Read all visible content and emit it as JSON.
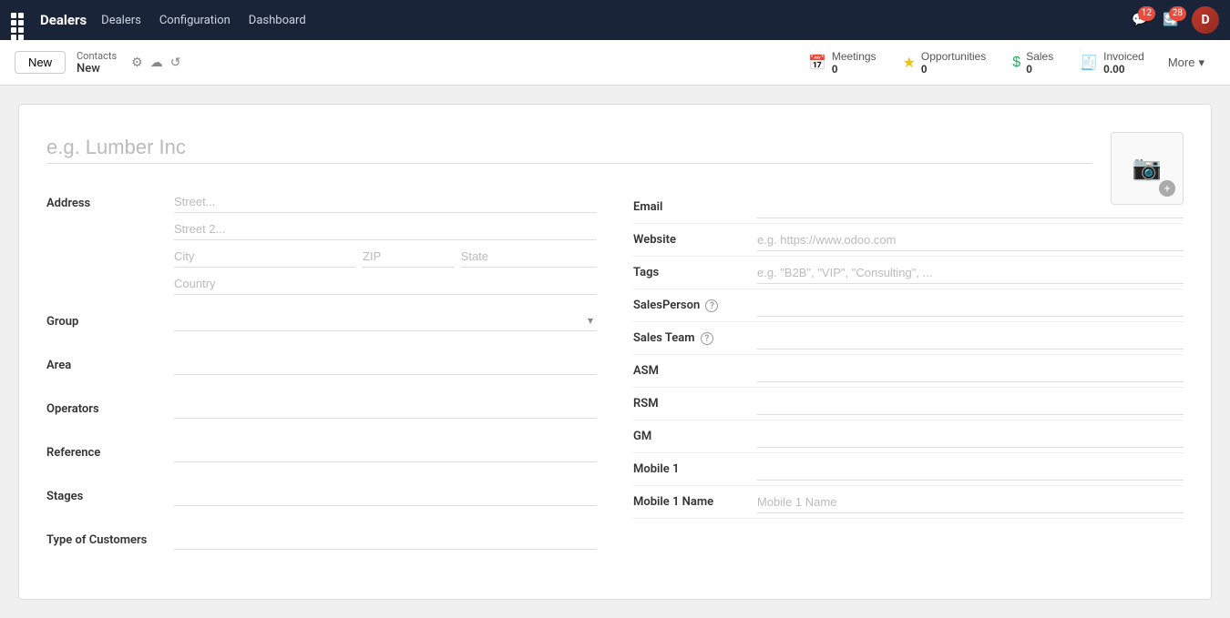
{
  "topnav": {
    "app_title": "Dealers",
    "nav_links": [
      "Dealers",
      "Configuration",
      "Dashboard"
    ],
    "chat_count": "12",
    "refresh_count": "28"
  },
  "actionbar": {
    "new_button": "New",
    "breadcrumb_parent": "Contacts",
    "breadcrumb_current": "New",
    "meetings_label": "Meetings",
    "meetings_count": "0",
    "opportunities_label": "Opportunities",
    "opportunities_count": "0",
    "sales_label": "Sales",
    "sales_count": "0",
    "invoiced_label": "Invoiced",
    "invoiced_count": "0.00",
    "more_label": "More"
  },
  "form": {
    "company_name_placeholder": "e.g. Lumber Inc",
    "address_label": "Address",
    "street_placeholder": "Street...",
    "street2_placeholder": "Street 2...",
    "city_placeholder": "City",
    "zip_placeholder": "ZIP",
    "state_placeholder": "State",
    "country_placeholder": "Country",
    "group_label": "Group",
    "area_label": "Area",
    "operators_label": "Operators",
    "reference_label": "Reference",
    "stages_label": "Stages",
    "type_of_customers_label": "Type of Customers",
    "email_label": "Email",
    "website_label": "Website",
    "website_placeholder": "e.g. https://www.odoo.com",
    "tags_label": "Tags",
    "tags_placeholder": "e.g. \"B2B\", \"VIP\", \"Consulting\", ...",
    "salesperson_label": "SalesPerson",
    "sales_team_label": "Sales Team",
    "asm_label": "ASM",
    "rsm_label": "RSM",
    "gm_label": "GM",
    "mobile1_label": "Mobile 1",
    "mobile1_name_label": "Mobile 1 Name",
    "mobile1_name_placeholder": "Mobile 1 Name"
  }
}
